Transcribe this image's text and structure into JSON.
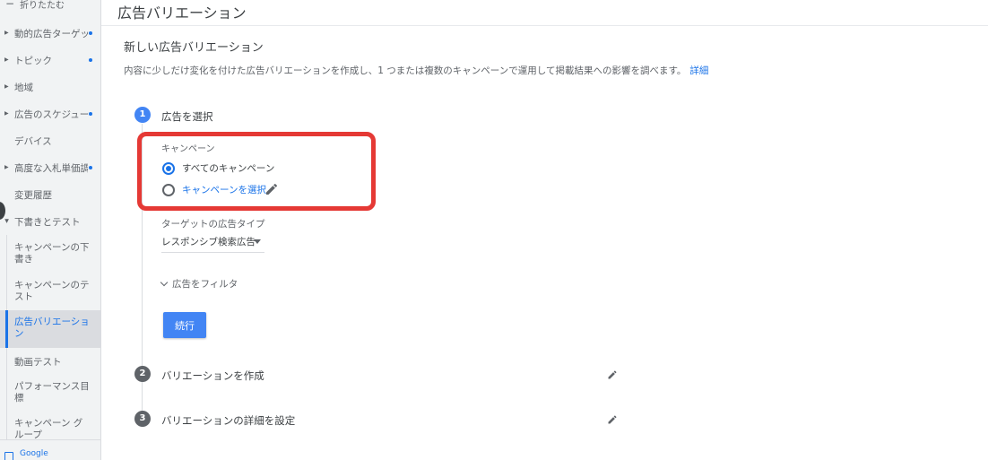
{
  "sidebar": {
    "collapse_label": "折りたたむ",
    "items": [
      {
        "label": "動的広告ターゲット"
      },
      {
        "label": "トピック"
      },
      {
        "label": "地域"
      },
      {
        "label": "広告のスケジュール"
      },
      {
        "label": "デバイス"
      },
      {
        "label": "高度な入札単価調整"
      },
      {
        "label": "変更履歴"
      },
      {
        "label": "下書きとテスト"
      },
      {
        "label": "キャンペーンの下書き"
      },
      {
        "label": "キャンペーンのテスト"
      },
      {
        "label": "広告バリエーション"
      },
      {
        "label": "動画テスト"
      },
      {
        "label": "パフォーマンス目標"
      },
      {
        "label": "キャンペーン グループ"
      }
    ],
    "bottom_label": "Google"
  },
  "header": {
    "title": "広告バリエーション"
  },
  "main": {
    "subtitle": "新しい広告バリエーション",
    "description": "内容に少しだけ変化を付けた広告バリエーションを作成し、1 つまたは複数のキャンペーンで運用して掲載結果への影響を調べます。",
    "description_link": "詳細",
    "steps": [
      {
        "number": "1",
        "title": "広告を選択"
      },
      {
        "number": "2",
        "title": "バリエーションを作成"
      },
      {
        "number": "3",
        "title": "バリエーションの詳細を設定"
      }
    ],
    "campaign_label": "キャンペーン",
    "radio_all": "すべてのキャンペーン",
    "radio_select": "キャンペーンを選択",
    "ad_type_label": "ターゲットの広告タイプ",
    "ad_type_value": "レスポンシブ検索広告",
    "filter_label": "広告をフィルタ",
    "continue_label": "続行"
  },
  "colors": {
    "accent": "#1a73e8",
    "step_active": "#4285f4",
    "highlight": "#e53935"
  }
}
